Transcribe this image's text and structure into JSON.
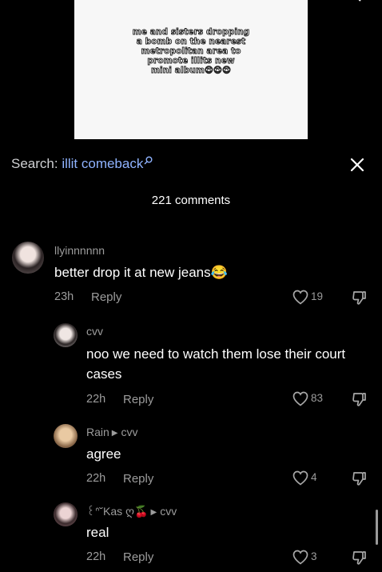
{
  "video": {
    "caption_lines": [
      "me and sisters dropping",
      "a bomb on the nearest",
      "metropolitan area to",
      "promote illits new",
      "mini album😍😍😍"
    ]
  },
  "search": {
    "prefix": "Search: ",
    "term": "illit comeback"
  },
  "comments_count": "221 comments",
  "comments": [
    {
      "username": "llyinnnnnn",
      "text": "better drop it at new jeans😂",
      "time": "23h",
      "reply_label": "Reply",
      "likes": "19"
    },
    {
      "username": "cvv",
      "text": "noo we need to watch them lose their court cases",
      "time": "22h",
      "reply_label": "Reply",
      "likes": "83"
    },
    {
      "username": "Rain",
      "reply_to": "cvv",
      "text": "agree",
      "time": "22h",
      "reply_label": "Reply",
      "likes": "4"
    },
    {
      "username": "꒰ᐢ˘Kas ღ🍒",
      "reply_to": "cvv",
      "text": "real",
      "time": "22h",
      "reply_label": "Reply",
      "likes": "3"
    }
  ],
  "icons": {
    "search": "search-icon",
    "close": "close-icon",
    "like": "heart-outline-icon",
    "dislike": "thumbs-down-icon"
  }
}
